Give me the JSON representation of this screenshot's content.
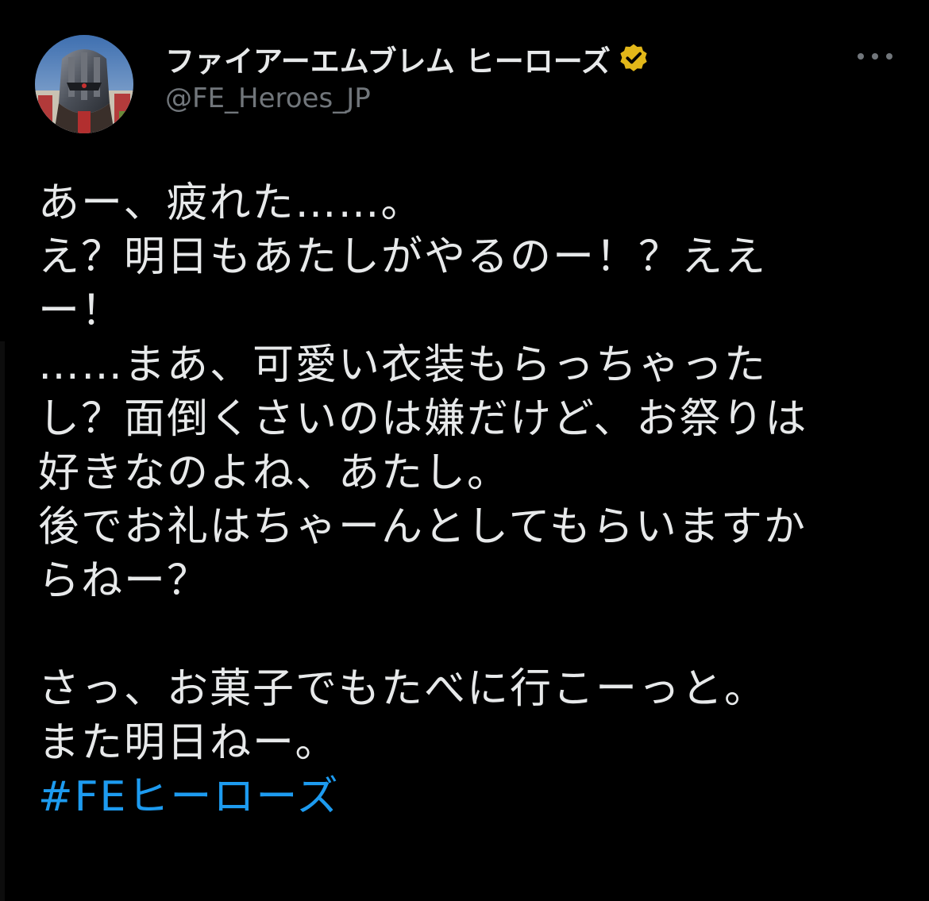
{
  "account": {
    "display_name": "ファイアーエムブレム ヒーローズ",
    "handle": "@FE_Heroes_JP",
    "verified_badge_color": "#e2b719"
  },
  "menu": {
    "icon": "more-horizontal-icon"
  },
  "tweet": {
    "lines": [
      "あー、疲れた……。",
      "え？明日もあたしがやるのー！？ええ",
      "ー！",
      "……まあ、可愛い衣装もらっちゃった",
      "し？面倒くさいのは嫌だけど、お祭りは",
      "好きなのよね、あたし。",
      "後でお礼はちゃーんとしてもらいますか",
      "らねー？",
      "",
      "さっ、お菓子でもたべに行こーっと。",
      "また明日ねー。"
    ],
    "hashtag": "#FEヒーローズ",
    "hashtag_color": "#1d9bf0"
  }
}
